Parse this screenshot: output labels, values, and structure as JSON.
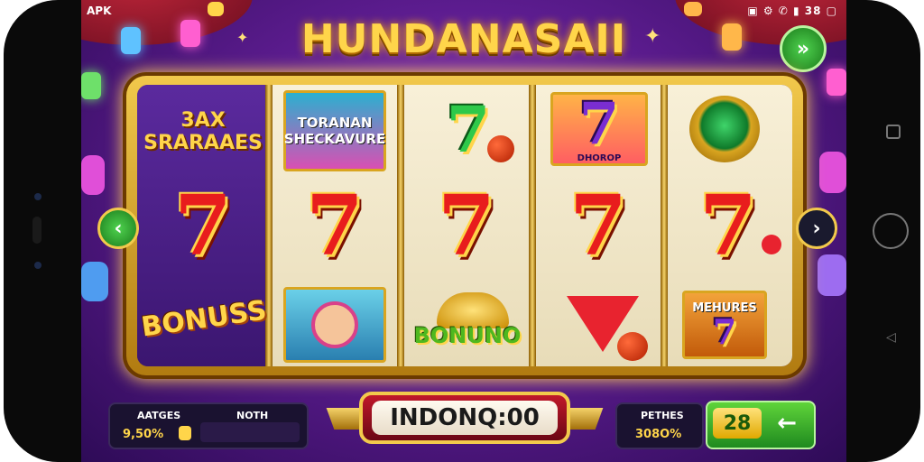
{
  "status_bar": {
    "app_label": "APK",
    "right_text": "▣ ⚙ ✆ ▮ 38 ▢"
  },
  "game": {
    "title": "HUNDANASAII",
    "reels": [
      {
        "top": {
          "kind": "text",
          "text": "3AX SRARAAES"
        },
        "middle": "7",
        "bottom": {
          "kind": "bonus",
          "text": "BONUSS"
        }
      },
      {
        "top": {
          "kind": "tile",
          "text": "TORANAN SHECKAVURE"
        },
        "middle": "7",
        "bottom": {
          "kind": "character"
        }
      },
      {
        "top": {
          "kind": "seven-green",
          "text": "7"
        },
        "middle": "7",
        "bottom": {
          "kind": "bonus",
          "text": "BONUNO"
        }
      },
      {
        "top": {
          "kind": "seven-tile",
          "text": "7",
          "caption": "DHOROP"
        },
        "middle": "7",
        "bottom": {
          "kind": "fruit"
        }
      },
      {
        "top": {
          "kind": "gem"
        },
        "middle": "7",
        "bottom": {
          "kind": "tile",
          "text": "MEHURES"
        }
      }
    ]
  },
  "panels": {
    "left": {
      "label_a": "AATGES",
      "value_a": "9,50%",
      "label_b": "NOTH",
      "value_b": ""
    },
    "right": {
      "label": "PETHES",
      "value": "308O%"
    }
  },
  "spin_button": {
    "label": "INDONQ:00"
  },
  "bet_badge": {
    "value": "28",
    "arrow": "←"
  },
  "colors": {
    "accent_gold": "#f2c94c",
    "spin_red": "#c0182a",
    "bg_purple": "#5c1c8f",
    "green": "#2fa52f"
  }
}
